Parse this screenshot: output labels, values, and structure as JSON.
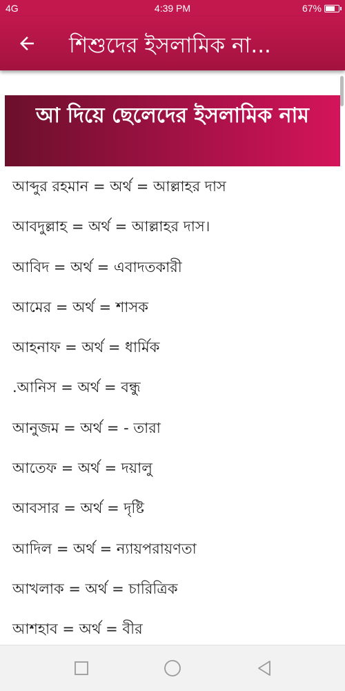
{
  "status_bar": {
    "signal": "4G",
    "time": "4:39 PM",
    "battery": "67%",
    "battery_level": 0.67
  },
  "app_bar": {
    "back_icon": "arrow-left-icon",
    "title": "শিশুদের ইসলামিক না..."
  },
  "section": {
    "title": "আ দিয়ে ছেলেদের ইসলামিক নাম"
  },
  "names": [
    "আব্দুর রহমান = অর্থ = আল্লাহর দাস",
    "আবদুল্লাহ = অর্থ = আল্লাহর দাস।",
    "আবিদ = অর্থ = এবাদতকারী",
    "আমের = অর্থ = শাসক",
    "আহনাফ = অর্থ = ধার্মিক",
    ".আনিস = অর্থ = বন্ধু",
    "আনুজম = অর্থ = - তারা",
    "আতেফ = অর্থ = দয়ালু",
    "আবসার = অর্থ = দৃষ্টি",
    "আদিল = অর্থ = ন্যায়পরায়ণতা",
    "আখলাক = অর্থ = চারিত্রিক",
    "আশহাব = অর্থ = বীর"
  ],
  "nav_bar": {
    "icons": [
      "square-icon",
      "circle-icon",
      "triangle-back-icon"
    ]
  },
  "colors": {
    "accent": "#c2184e",
    "header_gradient_start": "#6b0f2c",
    "header_gradient_end": "#d4145a"
  }
}
